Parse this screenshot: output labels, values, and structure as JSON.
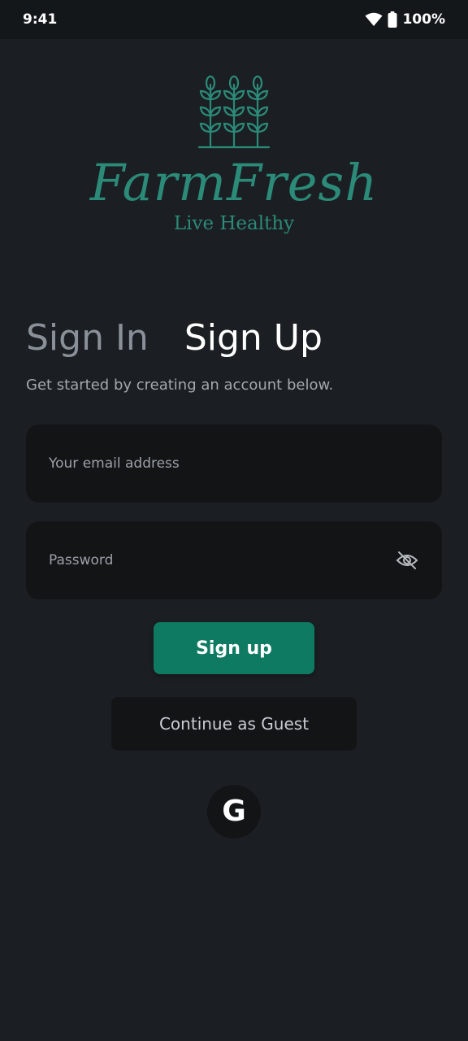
{
  "status_bar": {
    "time": "9:41",
    "battery_percent": "100%",
    "icons": [
      "wifi-icon",
      "battery-icon"
    ]
  },
  "brand": {
    "name": "FarmFresh",
    "tagline": "Live Healthy",
    "logo_icon": "wheat-icon",
    "color": "#2b8a78"
  },
  "auth": {
    "tabs": [
      {
        "label": "Sign In",
        "active": false
      },
      {
        "label": "Sign Up",
        "active": true
      }
    ],
    "subtitle": "Get started by creating an account below.",
    "email_placeholder": "Your email address",
    "email_value": "",
    "password_placeholder": "Password",
    "password_value": "",
    "password_toggle_icon": "eye-off-icon",
    "submit_label": "Sign up",
    "guest_label": "Continue as Guest",
    "google_icon": "google-icon"
  },
  "colors": {
    "background": "#1b1f23",
    "accent": "#0f7a62",
    "field_background": "#131416"
  }
}
